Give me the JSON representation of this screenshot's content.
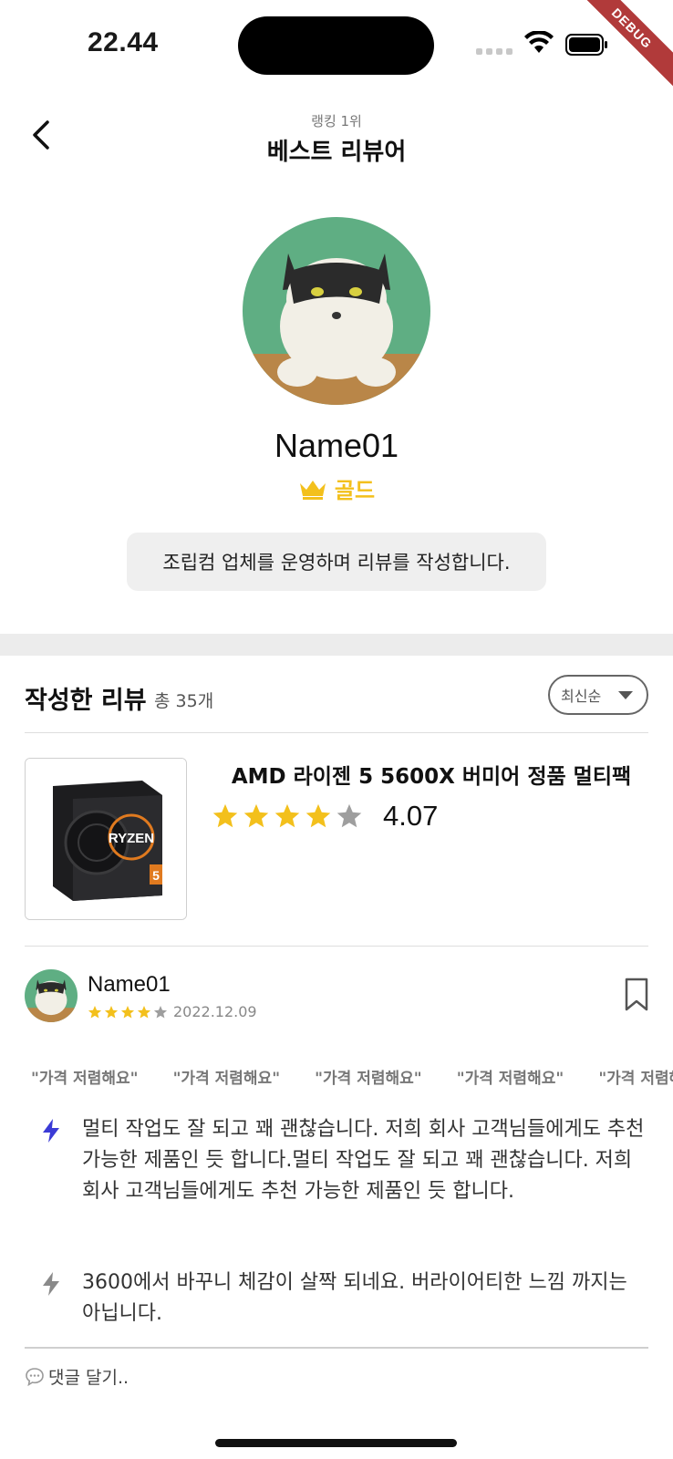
{
  "status_bar": {
    "time": "22.44",
    "debug_label": "DEBUG"
  },
  "nav": {
    "subtitle": "랭킹 1위",
    "title": "베스트 리뷰어"
  },
  "profile": {
    "name": "Name01",
    "grade": "골드",
    "grade_color": "#F3C01C",
    "bio": "조립컴 업체를 운영하며 리뷰를 작성합니다."
  },
  "reviews_section": {
    "title": "작성한 리뷰",
    "count": "총 35개",
    "sort": {
      "selected": "최신순"
    }
  },
  "product": {
    "name": "AMD 라이젠 5 5600X 버미어 정품 멀티팩",
    "rating": "4.07",
    "stars_filled": 4,
    "stars_total": 5,
    "box_text": "RYZEN",
    "box_number": "5"
  },
  "review": {
    "reviewer": "Name01",
    "stars_filled": 4,
    "stars_total": 5,
    "date": "2022.12.09",
    "tags": [
      "\"가격 저렴해요\"",
      "\"가격 저렴해요\"",
      "\"가격 저렴해요\"",
      "\"가격 저렴해요\"",
      "\"가격 저렴해요\""
    ],
    "points": [
      {
        "icon": "lightning-blue-icon",
        "text": "멀티 작업도 잘 되고 꽤 괜찮습니다. 저희 회사 고객님들에게도 추천 가능한 제품인 듯 합니다.멀티 작업도 잘 되고 꽤 괜찮습니다. 저희 회사 고객님들에게도 추천 가능한 제품인 듯 합니다."
      },
      {
        "icon": "lightning-gray-icon",
        "text": "3600에서 바꾸니 체감이 살짝 되네요. 버라이어티한 느낌 까지는 아닙니다."
      }
    ]
  },
  "comment": {
    "placeholder": "댓글 달기.."
  },
  "colors": {
    "star_active": "#F3C01C",
    "star_inactive": "#9E9E9E",
    "accent_blue": "#3B3BD6"
  }
}
